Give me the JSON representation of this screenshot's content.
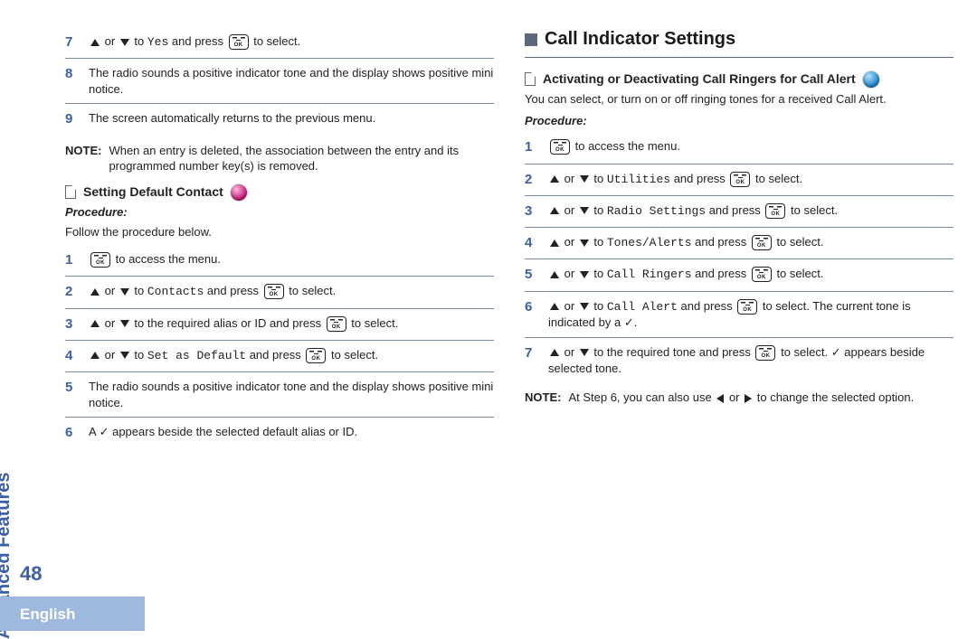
{
  "side_tab": "Advanced Features",
  "page_number": "48",
  "language": "English",
  "left": {
    "top_steps": [
      {
        "num": "7",
        "pre": " or ",
        "mid": " to ",
        "target": "Yes",
        "post1": " and press ",
        "post2": " to select."
      },
      {
        "num": "8",
        "text": "The radio sounds a positive indicator tone and the display shows positive mini notice."
      },
      {
        "num": "9",
        "text": "The screen automatically returns to the previous menu."
      }
    ],
    "note_label": "NOTE:",
    "note_text": "When an entry is deleted, the association between the entry and its programmed number key(s) is removed.",
    "sub_title": "Setting Default Contact",
    "procedure_label": "Procedure:",
    "procedure_intro": "Follow the procedure below.",
    "steps": [
      {
        "num": "1",
        "post": " to access the menu."
      },
      {
        "num": "2",
        "pre": " or ",
        "mid": " to ",
        "target": "Contacts",
        "post1": " and press ",
        "post2": " to select."
      },
      {
        "num": "3",
        "pre": " or ",
        "mid": " to the required alias or ID and press ",
        "post2": " to select."
      },
      {
        "num": "4",
        "pre": " or ",
        "mid": " to ",
        "target": "Set as Default",
        "post1": " and press ",
        "post2": " to select."
      },
      {
        "num": "5",
        "text": "The radio sounds a positive indicator tone and the display shows positive mini notice."
      },
      {
        "num": "6",
        "pretext": "A ",
        "check": "✓",
        "posttext": " appears beside the selected default alias or ID."
      }
    ]
  },
  "right": {
    "h2": "Call Indicator Settings",
    "sub_title": "Activating or Deactivating Call Ringers for Call Alert",
    "intro": "You can select, or turn on or off ringing tones for a received Call Alert.",
    "procedure_label": "Procedure:",
    "steps": [
      {
        "num": "1",
        "post": " to access the menu."
      },
      {
        "num": "2",
        "pre": " or ",
        "mid": " to ",
        "target": "Utilities",
        "post1": " and press ",
        "post2": " to select."
      },
      {
        "num": "3",
        "pre": " or ",
        "mid": " to ",
        "target": "Radio Settings",
        "post1": " and press ",
        "post2": " to select."
      },
      {
        "num": "4",
        "pre": " or ",
        "mid": " to ",
        "target": "Tones/Alerts",
        "post1": " and press ",
        "post2": " to select."
      },
      {
        "num": "5",
        "pre": " or ",
        "mid": " to ",
        "target": "Call Ringers",
        "post1": " and press ",
        "post2": " to select."
      },
      {
        "num": "6",
        "pre": " or ",
        "mid": " to ",
        "target": "Call Alert",
        "post1": " and press ",
        "post2a": " to select. The current tone is indicated by a ",
        "check": "✓",
        "post2b": "."
      },
      {
        "num": "7",
        "pre": " or ",
        "mid": " to the required tone and press ",
        "post2a": " to select. ",
        "check": "✓",
        "post2b": " appears beside selected tone."
      }
    ],
    "note_label": "NOTE:",
    "note_pre": "At Step 6, you can also use ",
    "note_mid": " or ",
    "note_post": " to change the selected option."
  }
}
